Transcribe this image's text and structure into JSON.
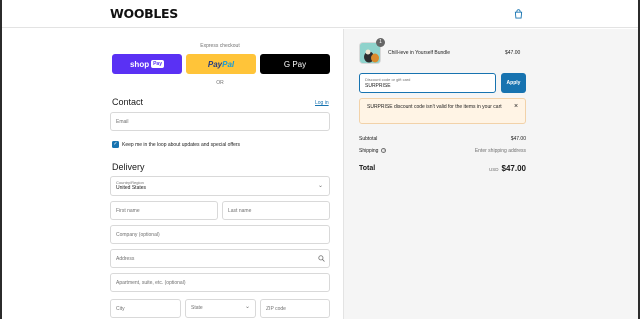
{
  "header": {
    "logo": "WOOBLES",
    "cart_icon": "shopping-bag-icon"
  },
  "express": {
    "label": "Express checkout",
    "shop_pay": "shop",
    "shop_pay_tag": "Pay",
    "paypal_a": "Pay",
    "paypal_b": "Pal",
    "gpay": "G Pay",
    "or": "OR"
  },
  "contact": {
    "heading": "Contact",
    "login": "Log in",
    "email_placeholder": "Email",
    "newsletter_label": "Keep me in the loop about updates and special offers",
    "newsletter_checked": true
  },
  "delivery": {
    "heading": "Delivery",
    "country_label": "Country/Region",
    "country_value": "United States",
    "first_name": "First name",
    "last_name": "Last name",
    "company": "Company (optional)",
    "address": "Address",
    "apartment": "Apartment, suite, etc. (optional)",
    "city": "City",
    "state": "State",
    "zip": "ZIP code"
  },
  "summary": {
    "item_name": "Chill-ieve in Yourself Bundle",
    "item_qty": "1",
    "item_price": "$47.00",
    "discount_label": "Discount code or gift card",
    "discount_value": "SURPRISE",
    "apply": "Apply",
    "alert_code": "SURPRISE",
    "alert_text": " discount code isn't valid for the items in your cart",
    "subtotal_label": "Subtotal",
    "subtotal_value": "$47.00",
    "shipping_label": "Shipping",
    "shipping_value": "Enter shipping address",
    "total_label": "Total",
    "total_currency": "USD",
    "total_value": "$47.00"
  },
  "colors": {
    "accent": "#1773b0",
    "shop_pay": "#5a31f4",
    "paypal": "#ffc439",
    "alert_bg": "#fff4e5"
  }
}
